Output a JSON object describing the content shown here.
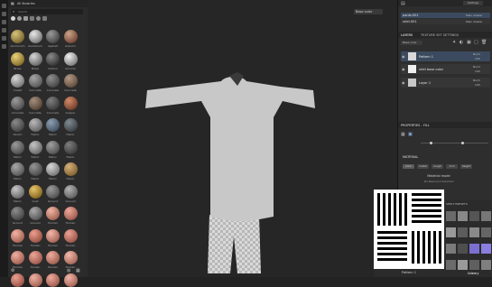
{
  "assets": {
    "title": "All libraries",
    "search_placeholder": "Search",
    "materials": [
      {
        "label": "Aluminium",
        "c1": "#d8c27a",
        "c2": "#6b5a26"
      },
      {
        "label": "Aluminium",
        "c1": "#e8e8e8",
        "c2": "#6a6a6a"
      },
      {
        "label": "Asphalt",
        "c1": "#9a9a9a",
        "c2": "#3a3a3a"
      },
      {
        "label": "Autumn",
        "c1": "#c9a58a",
        "c2": "#6b3b2b"
      },
      {
        "label": "Brass",
        "c1": "#ead27a",
        "c2": "#7a6120"
      },
      {
        "label": "Brass",
        "c1": "#d6d6d6",
        "c2": "#5a5a5a"
      },
      {
        "label": "Carbon",
        "c1": "#8a8a8a",
        "c2": "#2a2a2a"
      },
      {
        "label": "Chrome",
        "c1": "#f0f0f0",
        "c2": "#6e6e6e"
      },
      {
        "label": "Cobalt",
        "c1": "#d9d9d9",
        "c2": "#6a6a6a"
      },
      {
        "label": "Concrete",
        "c1": "#a6a6a6",
        "c2": "#4e4e4e"
      },
      {
        "label": "Concrete",
        "c1": "#8f8f8f",
        "c2": "#3d3d3d"
      },
      {
        "label": "Concrete",
        "c1": "#b29a86",
        "c2": "#5a4434"
      },
      {
        "label": "Concrete",
        "c1": "#9b9b9b",
        "c2": "#444444"
      },
      {
        "label": "Concrete",
        "c1": "#a38f7e",
        "c2": "#4d3b2e"
      },
      {
        "label": "Concrete",
        "c1": "#7e7e7e",
        "c2": "#333333"
      },
      {
        "label": "Copper",
        "c1": "#d08a6a",
        "c2": "#6a3622"
      },
      {
        "label": "Denim",
        "c1": "#8a8a8a",
        "c2": "#3b3b3b"
      },
      {
        "label": "Fabric",
        "c1": "#b9b9b9",
        "c2": "#5a5a5a"
      },
      {
        "label": "Fabric",
        "c1": "#8d9fb2",
        "c2": "#3a4a5a"
      },
      {
        "label": "Fabric",
        "c1": "#7f8a91",
        "c2": "#353b40"
      },
      {
        "label": "Fabric",
        "c1": "#9a9a9a",
        "c2": "#444444"
      },
      {
        "label": "Fabric",
        "c1": "#c4c4c4",
        "c2": "#5e5e5e"
      },
      {
        "label": "Fabric",
        "c1": "#a0a0a0",
        "c2": "#484848"
      },
      {
        "label": "Fabric",
        "c1": "#7e7e7e",
        "c2": "#343434"
      },
      {
        "label": "Fabric",
        "c1": "#a8a8a8",
        "c2": "#4d4d4d"
      },
      {
        "label": "Fabric",
        "c1": "#959595",
        "c2": "#404040"
      },
      {
        "label": "Fabric",
        "c1": "#d8d8d8",
        "c2": "#6a6a6a"
      },
      {
        "label": "Fabric",
        "c1": "#d6b07a",
        "c2": "#7a5a2a"
      },
      {
        "label": "Fabric",
        "c1": "#c8c8c8",
        "c2": "#5c5c5c"
      },
      {
        "label": "Gold",
        "c1": "#e6c46a",
        "c2": "#7a5c18"
      },
      {
        "label": "Ground",
        "c1": "#9b9b9b",
        "c2": "#474747"
      },
      {
        "label": "Ground",
        "c1": "#b4b4b4",
        "c2": "#555555"
      },
      {
        "label": "Ground",
        "c1": "#8c8c8c",
        "c2": "#3d3d3d"
      },
      {
        "label": "Ground",
        "c1": "#a9a9a9",
        "c2": "#4c4c4c"
      },
      {
        "label": "Human",
        "c1": "#f0b6a6",
        "c2": "#9a5a4a"
      },
      {
        "label": "Human",
        "c1": "#eda89a",
        "c2": "#955246"
      },
      {
        "label": "Human",
        "c1": "#f1b3a5",
        "c2": "#9a5849"
      },
      {
        "label": "Human",
        "c1": "#ee9e8e",
        "c2": "#8f4a3c"
      },
      {
        "label": "Human",
        "c1": "#f2b8aa",
        "c2": "#9c5b4d"
      },
      {
        "label": "Human",
        "c1": "#eba294",
        "c2": "#914d40"
      },
      {
        "label": "Human",
        "c1": "#f0b0a2",
        "c2": "#985547"
      },
      {
        "label": "Human",
        "c1": "#eca698",
        "c2": "#935043"
      },
      {
        "label": "Human",
        "c1": "#efae9f",
        "c2": "#975445"
      },
      {
        "label": "Human",
        "c1": "#f3baac",
        "c2": "#9d5d4f"
      },
      {
        "label": "",
        "c1": "#eaa092",
        "c2": "#8e4a3e"
      },
      {
        "label": "",
        "c1": "#f0b2a4",
        "c2": "#985648"
      },
      {
        "label": "",
        "c1": "#eeaa9c",
        "c2": "#955244"
      },
      {
        "label": "",
        "c1": "#f1b6a8",
        "c2": "#9a5a4b"
      }
    ]
  },
  "viewport": {
    "mode_value": "Base color"
  },
  "texture_sets": {
    "tabs": [
      "Settings"
    ],
    "items": [
      {
        "name": "pants.001",
        "shader": "Main shader"
      },
      {
        "name": "shirt.001",
        "shader": "Main shader"
      }
    ]
  },
  "layers": {
    "tab1": "LAYERS",
    "tab2": "TEXTURE SET SETTINGS",
    "channel": "Base color",
    "items": [
      {
        "name": "Pattern 1",
        "blend": "Norm",
        "opacity": "100"
      },
      {
        "name": "shirt base color",
        "blend": "Norm",
        "opacity": "100"
      },
      {
        "name": "Layer 1",
        "blend": "Norm",
        "opacity": "100"
      }
    ]
  },
  "properties": {
    "title": "PROPERTIES - FILL",
    "material_title": "MATERIAL",
    "buttons": [
      "color",
      "metal",
      "rough",
      "nrm",
      "height"
    ],
    "material_mode": "Material mode",
    "no_resource": "No Resource Selected"
  },
  "overlay": {
    "caption": "Pattern 1",
    "section": "SHELF PRESETS",
    "udemy": "Udemy"
  },
  "colors": {
    "accent": "#2f7fd6",
    "selected_row": "#3b4a5e"
  }
}
